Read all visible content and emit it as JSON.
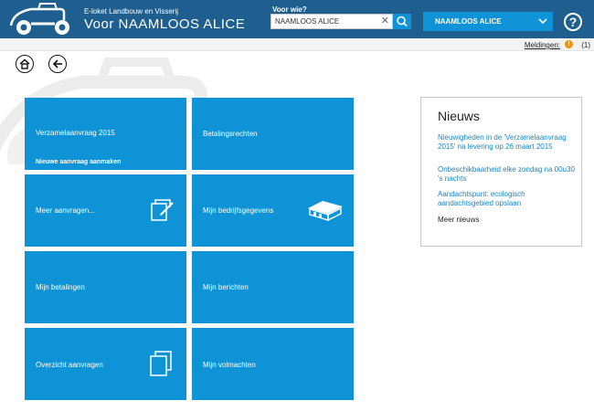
{
  "header": {
    "brand_sub": "E-loket Landbouw en Visserij",
    "brand_title": "Voor NAAMLOOS ALICE",
    "search_label": "Voor wie?",
    "search_value": "NAAMLOOS ALICE",
    "user_button": "NAAMLOOS ALICE",
    "help": "?"
  },
  "notifications": {
    "label": "Meldingen:",
    "icon": "!",
    "count": "(1)"
  },
  "tiles": [
    {
      "title": "Verzamelaanvraag 2015",
      "sub": "Nieuwe aanvraag aanmaken"
    },
    {
      "title": "Betalingsrechten"
    },
    {
      "title": "Meer aanvragen...",
      "icon": "documents-edit-icon"
    },
    {
      "title": "Mijn bedrijfsgegevens",
      "icon": "barn-icon"
    },
    {
      "title": "Mijn betalingen"
    },
    {
      "title": "Mijn berichten"
    },
    {
      "title": "Overzicht aanvragen",
      "icon": "documents-icon"
    },
    {
      "title": "Mijn volmachten"
    }
  ],
  "news": {
    "title": "Nieuws",
    "items": [
      "Nieuwigheden in de 'Verzamelaanvraag 2015' na levering op 26 maart 2015",
      "Onbeschikbaarheid elke zondag na 00u30 's nachts",
      "Aandachtspunt: ecologisch aandachtsgebied opslaan"
    ],
    "more": "Meer nieuws"
  },
  "colors": {
    "header": "#1f5f8f",
    "tile": "#0d93d6",
    "link": "#1a86c8",
    "warning": "#f39200"
  }
}
